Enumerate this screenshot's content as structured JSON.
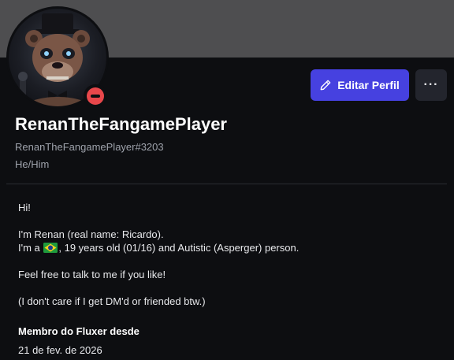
{
  "profile": {
    "display_name": "RenanTheFangamePlayer",
    "username": "RenanTheFangamePlayer#3203",
    "pronouns": "He/Him",
    "status": "do-not-disturb",
    "avatar_icon": "animatronic-bear-avatar"
  },
  "actions": {
    "edit_label": "Editar Perfil",
    "edit_icon": "pencil-icon",
    "more_label": "···"
  },
  "bio": {
    "line1": "Hi!",
    "line2": "I'm Renan (real name: Ricardo).",
    "line3_prefix": "I'm a",
    "line3_flag": "brazil-flag-emoji",
    "line3_suffix": ", 19 years old (01/16) and Autistic (Asperger) person.",
    "line4": "Feel free to talk to me if you like!",
    "line5": "(I don't care if I get DM'd or friended btw.)"
  },
  "member": {
    "title": "Membro do Fluxer desde",
    "date": "21 de fev. de 2026"
  },
  "colors": {
    "banner": "#4e4e50",
    "background": "#0d0e11",
    "accent": "#4641e0",
    "dnd": "#e8474b"
  }
}
